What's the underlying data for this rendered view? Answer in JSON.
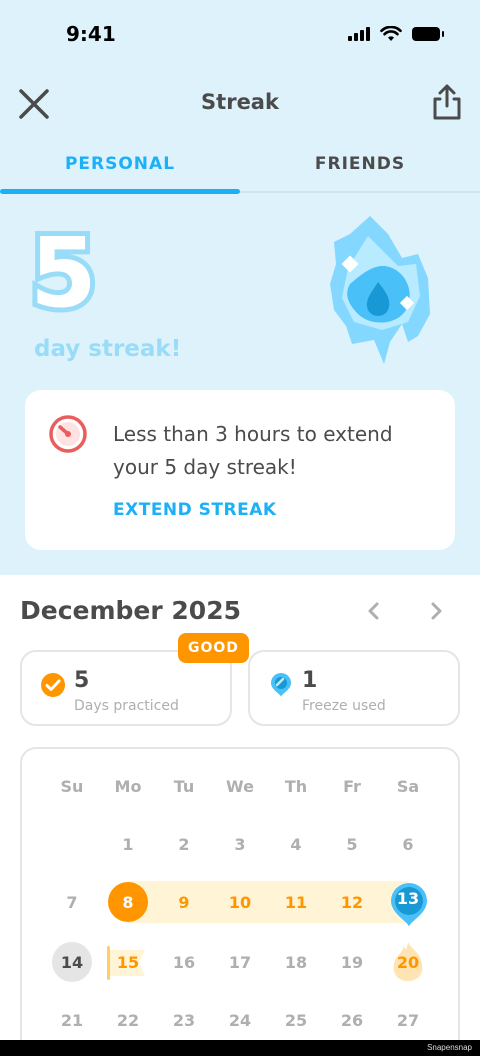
{
  "status_bar": {
    "time": "9:41"
  },
  "header": {
    "title": "Streak"
  },
  "tabs": [
    {
      "label": "PERSONAL",
      "active": true
    },
    {
      "label": "FRIENDS",
      "active": false
    }
  ],
  "streak": {
    "count": "5",
    "label": "day streak!"
  },
  "warning": {
    "message": "Less than 3 hours to extend your 5 day streak!",
    "action": "EXTEND STREAK"
  },
  "calendar": {
    "month": "December 2025",
    "weekdays": [
      "Su",
      "Mo",
      "Tu",
      "We",
      "Th",
      "Fr",
      "Sa"
    ],
    "rows": [
      [
        "",
        "1",
        "2",
        "3",
        "4",
        "5",
        "6"
      ],
      [
        "7",
        "8",
        "9",
        "10",
        "11",
        "12",
        "13"
      ],
      [
        "14",
        "15",
        "16",
        "17",
        "18",
        "19",
        "20"
      ],
      [
        "21",
        "22",
        "23",
        "24",
        "25",
        "26",
        "27"
      ]
    ]
  },
  "stats": {
    "badge": "GOOD",
    "days_practiced": {
      "value": "5",
      "label": "Days practiced"
    },
    "freeze_used": {
      "value": "1",
      "label": "Freeze used"
    }
  },
  "colors": {
    "accent_blue": "#1cb0f6",
    "streak_orange": "#ff9600",
    "header_bg": "#def2fc"
  },
  "watermark": "Snapensnap"
}
